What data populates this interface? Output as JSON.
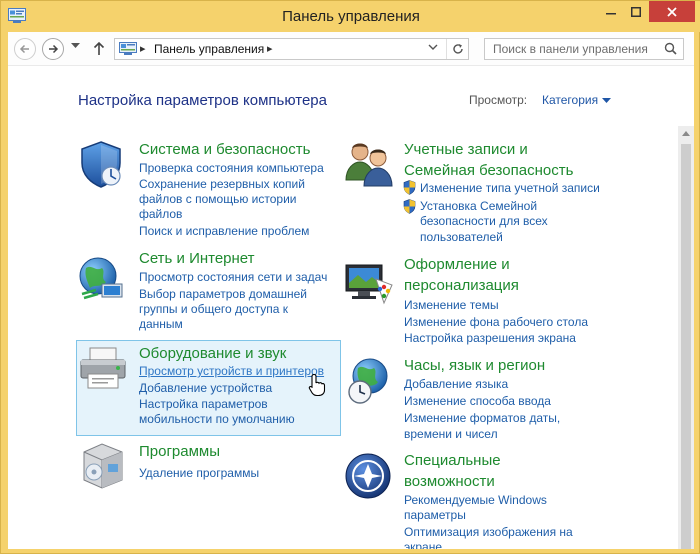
{
  "window": {
    "title": "Панель управления",
    "controls": {
      "minimize": "—",
      "maximize": "▭",
      "close": "✕"
    }
  },
  "navbar": {
    "address": "Панель управления",
    "search_placeholder": "Поиск в панели управления"
  },
  "content": {
    "heading": "Настройка параметров компьютера",
    "view_label": "Просмотр:",
    "view_value": "Категория"
  },
  "categories": {
    "system": {
      "title": "Система и безопасность",
      "links": [
        "Проверка состояния компьютера",
        "Сохранение резервных копий",
        "файлов с помощью истории",
        "файлов",
        "Поиск и исправление проблем"
      ]
    },
    "network": {
      "title": "Сеть и Интернет",
      "links": [
        "Просмотр состояния сети и задач",
        "Выбор параметров домашней",
        "группы и общего доступа к",
        "данным"
      ]
    },
    "hardware": {
      "title": "Оборудование и звук",
      "links": [
        "Просмотр устройств и принтеров",
        "Добавление устройства",
        "Настройка параметров",
        "мобильности по умолчанию"
      ]
    },
    "programs": {
      "title": "Программы",
      "links": [
        "Удаление программы"
      ]
    },
    "accounts": {
      "title_line1": "Учетные записи и",
      "title_line2": "Семейная безопасность",
      "links": [
        "Изменение типа учетной записи",
        "Установка Семейной",
        "безопасности для всех",
        "пользователей"
      ]
    },
    "appearance": {
      "title_line1": "Оформление и",
      "title_line2": "персонализация",
      "links": [
        "Изменение темы",
        "Изменение фона рабочего стола",
        "Настройка разрешения экрана"
      ]
    },
    "clock": {
      "title": "Часы, язык и регион",
      "links": [
        "Добавление языка",
        "Изменение способа ввода",
        "Изменение форматов даты,",
        "времени и чисел"
      ]
    },
    "access": {
      "title_line1": "Специальные",
      "title_line2": "возможности",
      "links": [
        "Рекомендуемые Windows",
        "параметры",
        "Оптимизация изображения на",
        "экране"
      ]
    }
  },
  "icons": {
    "title": "control-panel-icon",
    "back": "arrow-left-icon",
    "forward": "arrow-right-icon",
    "up": "arrow-up-icon",
    "refresh": "refresh-icon",
    "search": "search-icon",
    "system": "shield-icon",
    "network": "globe-network-icon",
    "hardware": "printer-icon",
    "programs": "programs-box-icon",
    "accounts": "users-icon",
    "appearance": "monitor-palette-icon",
    "clock": "globe-clock-icon",
    "access": "accessibility-icon"
  },
  "colors": {
    "titlebar": "#f5d26c",
    "close": "#c7403a",
    "heading": "#1e3287",
    "category_title": "#1e8a2f",
    "link": "#1f5ea9",
    "hover_bg": "#e5f3fb",
    "hover_border": "#7fc4e8"
  }
}
